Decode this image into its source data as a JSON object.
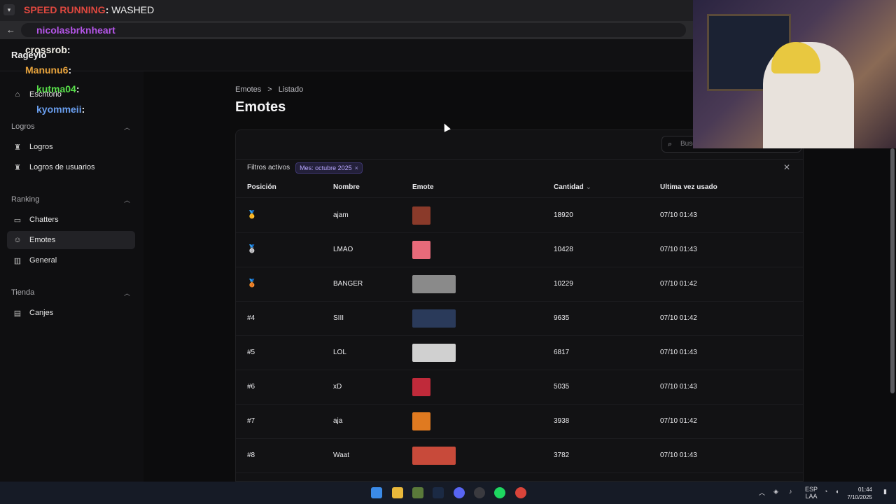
{
  "overlay": {
    "chat": [
      {
        "user": "SPEED RUNNING",
        "sep": ": ",
        "text": "WASHED",
        "color": "#e0483f"
      },
      {
        "user": "nicolasbrknheart",
        "sep": "",
        "text": "",
        "color": "#b455e8"
      },
      {
        "user": "crossrob",
        "sep": ": ",
        "text": "",
        "color": "#f2efe6"
      },
      {
        "user": "Manunu6",
        "sep": ": ",
        "text": "",
        "color": "#e6a23c"
      },
      {
        "user": "kutma04",
        "sep": ": ",
        "text": "",
        "color": "#58e04a"
      },
      {
        "user": "kyommeii",
        "sep": ": ",
        "text": "",
        "color": "#6a9ff0"
      }
    ]
  },
  "app": {
    "brand": "Rageylo"
  },
  "sidebar": {
    "home": {
      "label": "Escritorio",
      "icon": "home-icon"
    },
    "sections": [
      {
        "label": "Logros",
        "items": [
          {
            "label": "Logros",
            "icon": "trophy-icon"
          },
          {
            "label": "Logros de usuarios",
            "icon": "trophy-icon"
          }
        ]
      },
      {
        "label": "Ranking",
        "items": [
          {
            "label": "Chatters",
            "icon": "chat-icon"
          },
          {
            "label": "Emotes",
            "icon": "smile-icon",
            "active": true
          },
          {
            "label": "General",
            "icon": "bar-chart-icon"
          }
        ]
      },
      {
        "label": "Tienda",
        "items": [
          {
            "label": "Canjes",
            "icon": "wallet-icon"
          }
        ]
      }
    ]
  },
  "breadcrumb": {
    "first": "Emotes",
    "separator": ">",
    "second": "Listado"
  },
  "page": {
    "title": "Emotes"
  },
  "search": {
    "placeholder": "Buscar"
  },
  "filters": {
    "label": "Filtros activos",
    "chip": "Mes: octubre 2025"
  },
  "table": {
    "headers": {
      "position": "Posición",
      "name": "Nombre",
      "emote": "Emote",
      "count": "Cantidad",
      "last_used": "Ultima vez usado"
    },
    "rows": [
      {
        "position": "🥇",
        "name": "ajam",
        "count": "18920",
        "last_used": "07/10 01:43",
        "emote_color": "#8a3a2a",
        "emote_wide": false
      },
      {
        "position": "🥈",
        "name": "LMAO",
        "count": "10428",
        "last_used": "07/10 01:43",
        "emote_color": "#e86a7a",
        "emote_wide": false
      },
      {
        "position": "🥉",
        "name": "BANGER",
        "count": "10229",
        "last_used": "07/10 01:42",
        "emote_color": "#8a8a8a",
        "emote_wide": true
      },
      {
        "position": "#4",
        "name": "SIII",
        "count": "9635",
        "last_used": "07/10 01:42",
        "emote_color": "#2a3a5a",
        "emote_wide": true
      },
      {
        "position": "#5",
        "name": "LOL",
        "count": "6817",
        "last_used": "07/10 01:43",
        "emote_color": "#d0d0d0",
        "emote_wide": true
      },
      {
        "position": "#6",
        "name": "xD",
        "count": "5035",
        "last_used": "07/10 01:43",
        "emote_color": "#c02a3a",
        "emote_wide": false
      },
      {
        "position": "#7",
        "name": "aja",
        "count": "3938",
        "last_used": "07/10 01:42",
        "emote_color": "#e07a20",
        "emote_wide": false
      },
      {
        "position": "#8",
        "name": "Waat",
        "count": "3782",
        "last_used": "07/10 01:43",
        "emote_color": "#c84a3a",
        "emote_wide": true
      }
    ]
  },
  "taskbar": {
    "lang_top": "ESP",
    "lang_bottom": "LAA",
    "time": "01:44",
    "date": "7/10/2025"
  }
}
